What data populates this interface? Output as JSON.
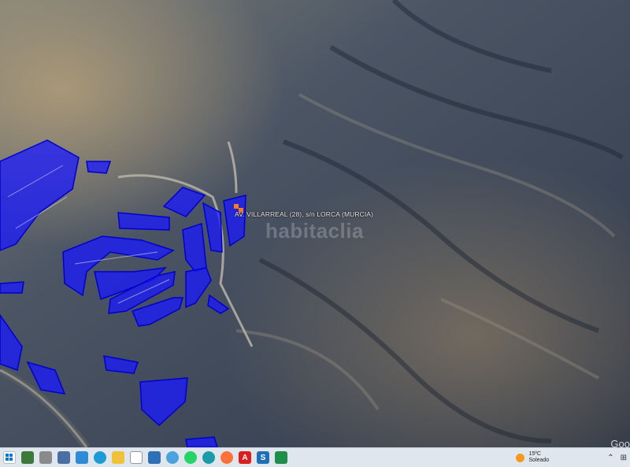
{
  "map": {
    "label": "AV. VILLARREAL (28), s/n LORCA (MURCIA)",
    "watermark": "habitaclia",
    "attribution": "Goo",
    "colors": {
      "parcel_fill": "#1a1aff",
      "parcel_stroke": "#0000cc",
      "marker": "#ff7a1a"
    }
  },
  "taskbar": {
    "icons": [
      "windows-start-icon",
      "calendar-app-icon",
      "file-app-icon",
      "network-app-icon",
      "image-app-icon",
      "edge-browser-icon",
      "file-explorer-icon",
      "document-icon",
      "recycle-icon",
      "globe-icon",
      "whatsapp-icon",
      "swirl-app-icon",
      "firefox-icon",
      "acrobat-icon",
      "s-app-icon",
      "spreadsheet-app-icon"
    ],
    "weather": {
      "temp": "15ºC",
      "condition": "Soleado"
    }
  }
}
